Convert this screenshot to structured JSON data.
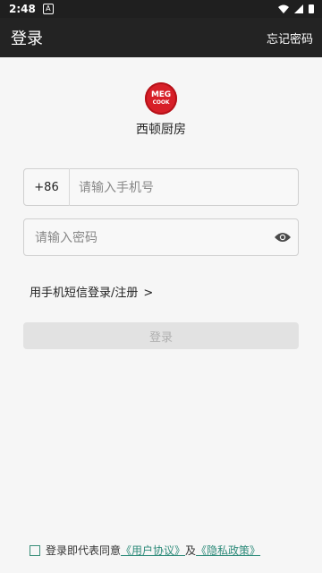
{
  "status": {
    "time": "2:48",
    "a_badge": "A"
  },
  "header": {
    "title": "登录",
    "forgot_password": "忘记密码"
  },
  "brand": {
    "logo_line1": "MEG",
    "logo_line2": "COOK",
    "name": "西顿厨房"
  },
  "form": {
    "country_code": "+86",
    "phone_placeholder": "请输入手机号",
    "password_placeholder": "请输入密码"
  },
  "links": {
    "sms_login": "用手机短信登录/注册",
    "sms_chevron": ">"
  },
  "buttons": {
    "login": "登录"
  },
  "agreement": {
    "prefix": "登录即代表同意",
    "terms": "《用户协议》",
    "and": "及",
    "privacy": "《隐私政策》"
  },
  "colors": {
    "accent": "#2e8b7a",
    "logo": "#d71f28",
    "app_bar": "#232323"
  }
}
